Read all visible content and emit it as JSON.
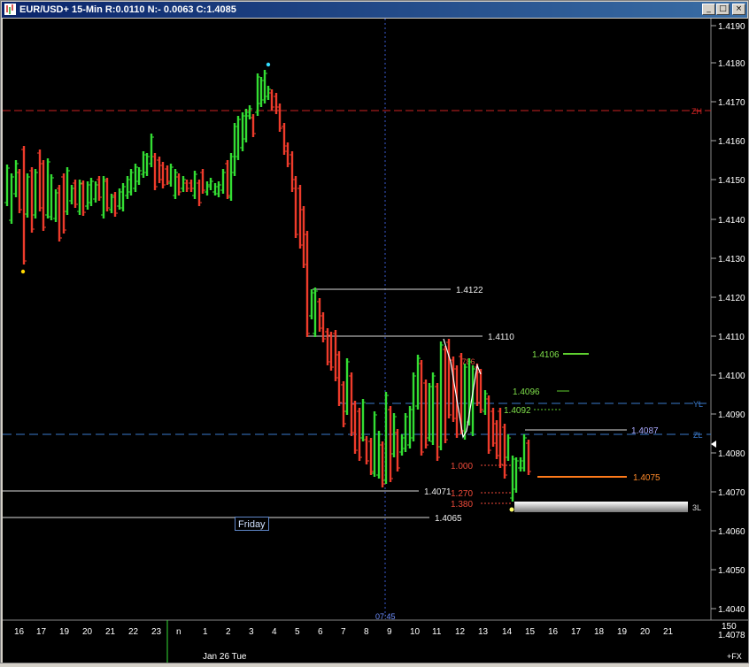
{
  "window": {
    "title": "EUR/USD+ 15-Min R:0.0110 N:- 0.0063 C:1.4085",
    "minimize_glyph": "_",
    "maximize_glyph": "□",
    "close_glyph": "×"
  },
  "colors": {
    "up_bar": "#33dd33",
    "down_bar": "#ee3b2b",
    "background": "#000000",
    "zh_line": "#cc2222",
    "yl_line": "#3a7acc",
    "zl_line": "#3a7acc"
  },
  "price_axis": {
    "ticks": [
      "1.4190",
      "1.4180",
      "1.4170",
      "1.4160",
      "1.4150",
      "1.4140",
      "1.4130",
      "1.4120",
      "1.4110",
      "1.4100",
      "1.4090",
      "1.4080",
      "1.4070",
      "1.4060",
      "1.4050",
      "1.4040"
    ],
    "bar_count_label": "150",
    "last_price_label": "1.4078"
  },
  "time_axis": {
    "ticks": [
      "16",
      "17",
      "19",
      "20",
      "21",
      "22",
      "23",
      "n",
      "1",
      "2",
      "3",
      "4",
      "5",
      "6",
      "7",
      "8",
      "9",
      "10",
      "11",
      "12",
      "13",
      "14",
      "15",
      "16",
      "17",
      "18",
      "19",
      "20",
      "21"
    ],
    "date_label": "Jan 26 Tue",
    "cursor_time": "07:45",
    "corner_label": "+FX"
  },
  "levels": {
    "zh": "ZH",
    "yl": "YL",
    "zl": "ZL",
    "three_l": "3L",
    "l1_4122": "1.4122",
    "l1_4110": "1.4110",
    "l1_4106": "1.4106",
    "l1_4096": "1.4096",
    "l1_4092": "1.4092",
    "l1_4087": "1.4087",
    "l1_4075": "1.4075",
    "l1_4071": "1.4071",
    "l1_4065": "1.4065",
    "fib_786": ".786",
    "fib_1000": "1.000",
    "fib_1270": "1.270",
    "fib_1380": "1.380"
  },
  "annotation": {
    "friday": "Friday"
  }
}
